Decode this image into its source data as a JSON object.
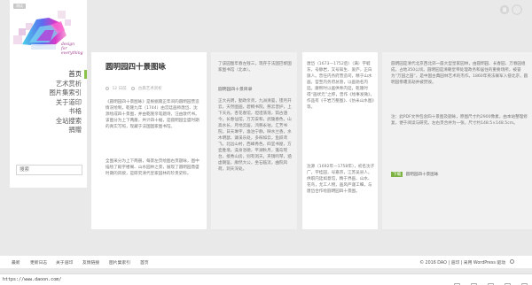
{
  "logo": {
    "badge": "测试",
    "tagline": "design\nfor\neverything"
  },
  "nav": {
    "items": [
      "首页",
      "艺术赏析",
      "图片集索引",
      "关于道印",
      "书格",
      "全站搜索",
      "捐赠"
    ],
    "active_index": 0
  },
  "search": {
    "placeholder": "搜索"
  },
  "post": {
    "title": "圆明园四十景图咏",
    "meta": {
      "date": "12 日前",
      "category": "古典艺术赏析"
    },
    "paragraphs": [
      "《圆明园四十景图咏》是根据雍正年间的圆明园营造情况绘制，乾隆九年（1744）由宫廷画师唐岱、沈源绘成四十景图，并由乾隆亲笔题诗，汪由敦代书。该图分为上下两册，共计四十幅，是圆明园全盛时期的真实写照，现藏于法国国家图书馆。",
      "全图采分为上下两册，每景左页绘图右页题咏，图中描绘了殿宇楼阁、山水园林之景，展现了圆明园鼎盛时期的风貌，是研究清代皇家园林的珍贵史料。"
    ]
  },
  "card2": {
    "intro": "了该园图年春左钱三，现存于法国巴黎国家图书馆（北本）。",
    "heading": "圆明园四十景目录",
    "list": "正大光明，勤政亲贤，九洲清晏，镂月开云，天然图画，碧桐书院，慈云普护，上下天光，杏花春馆，坦坦荡荡，茹古涵今，长春仙馆，万方安和，武陵春色，山高水长，月地云居，鸿慈永祜，汇芳书院，日天琳宇，澹泊宁静，映水兰香，水木明瑟，濂溪乐处，多稼如云，鱼跃鸢飞，北远山村，西峰秀色，四宜书屋，方壶胜境，澡身浴德，平湖秋月，蓬岛瑶台，接秀山房，别有洞天，夹镜鸣琴，涵虚朗鉴，廓然大公，坐石临流，曲院风荷，洞天深处。"
  },
  "card3": {
    "p1": "唐岱（1673—1752后）（满）字毓东，号静岩，又号知生、爱庐，正白旗人。曾任内务府营造司，精于山水画，官至内务府总管，以画驰名内廷。康熙时以画供奉内廷，乾隆时得“画状元”之称，曾作《绘事发微》，作品有《千岩万壑图》、《仿米山水图》等。",
    "p2": "沈源（1692年—1758年），初名沈子广，字桂园，号嘉宗，江苏吴县人。供职内廷如意馆，精于界画、山水、花鸟，尤工人物，画风严谨工细，与唐岱合作绘圆明园四十景图。"
  },
  "card4": {
    "p1": "圆明园是清代北京西北郊一座大型皇家园林，由圆明园、长春园、万春园组成，占地350公顷。圆明园是清朝皇帝处理政务和居住的重要场所，被誉为“万园之园”，是中国古典园林艺术的杰作。1860年英法联军入侵北京，圆明园惨遭洗劫并被焚毁。",
    "p2": "注：此PDF文件包含四十景图及题咏，原图尺寸约2900像素，由本站整理修复，便于阅读与研究。左右页合并为一张，尺寸约148.5×148.5cm。",
    "download_tag": "下载",
    "download_text": "圆明园四十景图咏"
  },
  "footer": {
    "links": [
      "最新",
      "更新日志",
      "关于道印",
      "友情链接",
      "图片集索引",
      "首页"
    ],
    "copyright": "© 2016 DAO | 道印 | 采用 WordPress 驱动"
  },
  "status": {
    "url": "https://www.daoon.com/"
  },
  "colors": {
    "accent": "#8bc34a",
    "download": "#7cb342",
    "background": "#e9e9e9"
  }
}
